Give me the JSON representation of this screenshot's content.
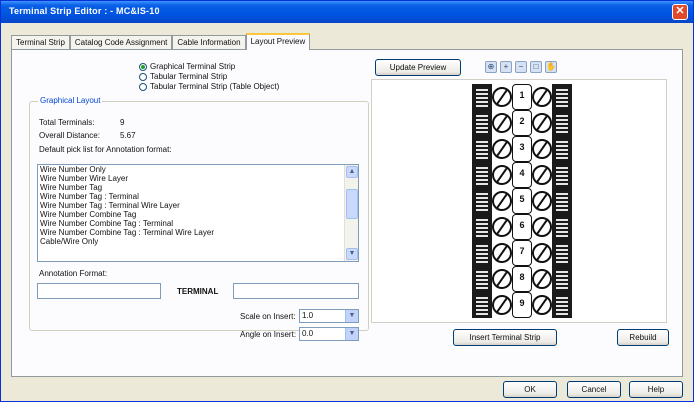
{
  "window": {
    "title": "Terminal Strip Editor : - MC&IS-10",
    "close_label": "✕"
  },
  "tabs": [
    {
      "label": "Terminal Strip"
    },
    {
      "label": "Catalog Code Assignment"
    },
    {
      "label": "Cable Information"
    },
    {
      "label": "Layout Preview"
    }
  ],
  "layout_types": [
    {
      "label": "Graphical Terminal Strip",
      "checked": true
    },
    {
      "label": "Tabular Terminal Strip",
      "checked": false
    },
    {
      "label": "Tabular Terminal Strip (Table Object)",
      "checked": false
    }
  ],
  "graphical_layout": {
    "group_title": "Graphical Layout",
    "total_terminals_label": "Total Terminals:",
    "total_terminals_value": "9",
    "overall_distance_label": "Overall Distance:",
    "overall_distance_value": "5.67",
    "pick_list_label": "Default pick list for Annotation format:",
    "pick_list_items": [
      "Wire Number Only",
      "Wire Number Wire Layer",
      "Wire Number Tag",
      "Wire Number Tag : Terminal",
      "Wire Number Tag : Terminal Wire Layer",
      "Wire Number Combine Tag",
      "Wire Number Combine Tag : Terminal",
      "Wire Number Combine Tag : Terminal Wire Layer",
      "Cable/Wire Only"
    ],
    "annotation_format_label": "Annotation Format:",
    "annotation_left_value": "",
    "terminal_keyword": "TERMINAL",
    "annotation_right_value": "",
    "scale_label": "Scale on Insert:",
    "scale_value": "1.0",
    "angle_label": "Angle on Insert:",
    "angle_value": "0.0"
  },
  "preview": {
    "update_label": "Update Preview",
    "zoom_icons": [
      "zoom-extents-icon",
      "zoom-in-icon",
      "zoom-out-icon",
      "zoom-window-icon",
      "pan-icon"
    ],
    "terminal_count": 9,
    "terminal_numbers": [
      "1",
      "2",
      "3",
      "4",
      "5",
      "6",
      "7",
      "8",
      "9"
    ]
  },
  "buttons": {
    "insert_strip": "Insert Terminal Strip",
    "rebuild": "Rebuild",
    "ok": "OK",
    "cancel": "Cancel",
    "help": "Help"
  }
}
